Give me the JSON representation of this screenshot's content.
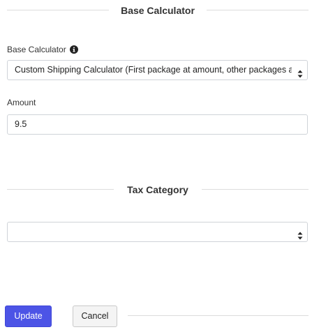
{
  "base_calculator_section": {
    "title": "Base Calculator"
  },
  "base_calculator_field": {
    "label": "Base Calculator",
    "info_icon": "info-circle-icon",
    "selected_value": "Custom Shipping Calculator (First package at amount, other packages at amount)"
  },
  "amount_field": {
    "label": "Amount",
    "value": "9.5"
  },
  "tax_category_section": {
    "title": "Tax Category"
  },
  "tax_category_field": {
    "selected_value": ""
  },
  "actions": {
    "update_label": "Update",
    "cancel_label": "Cancel"
  },
  "colors": {
    "primary": "#4c54e6",
    "rule": "#dcdcdc"
  }
}
